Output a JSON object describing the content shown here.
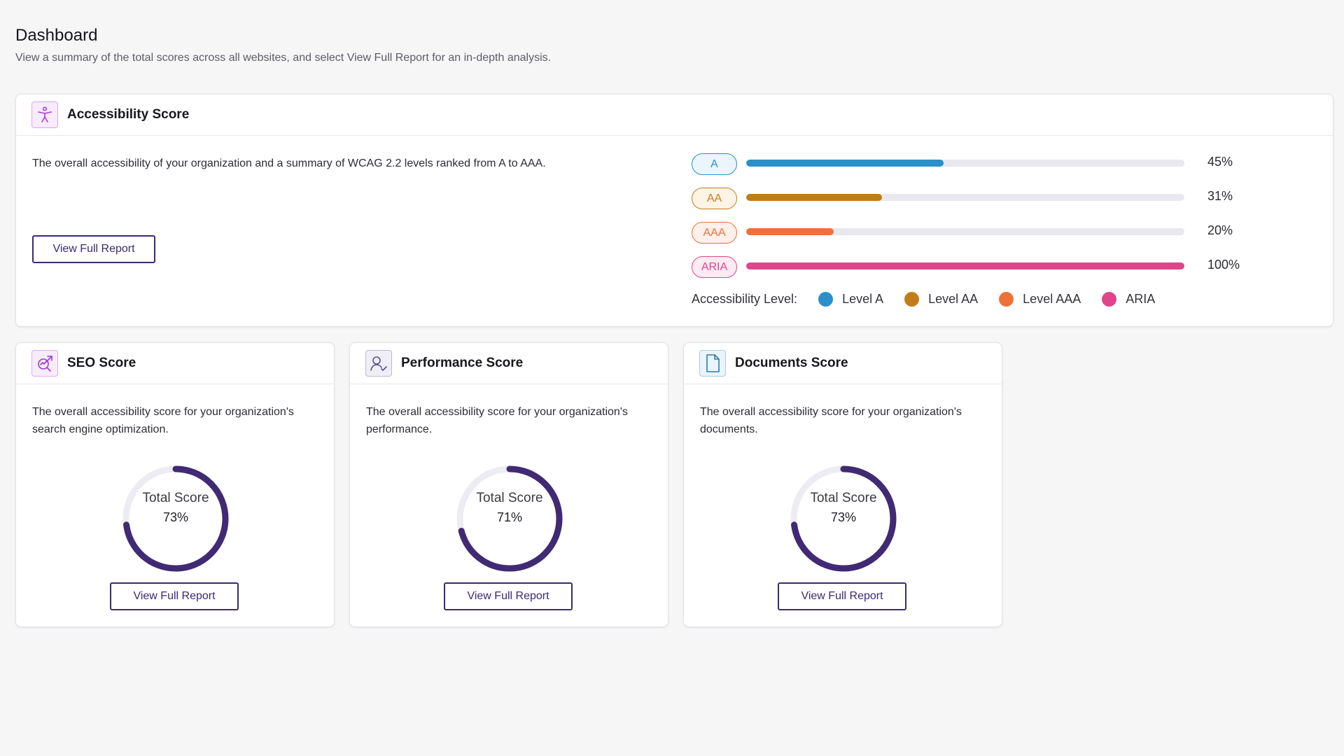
{
  "page": {
    "title": "Dashboard",
    "subtitle": "View a summary of the total scores across all websites, and select View Full Report for an in-depth analysis."
  },
  "accessibility": {
    "title": "Accessibility Score",
    "icon": "accessibility-person-icon",
    "description": "The overall accessibility of your organization and a summary of WCAG 2.2 levels ranked from A to AAA.",
    "button_label": "View Full Report",
    "levels": [
      {
        "label": "A",
        "percent_text": "45%",
        "value": 45,
        "color": "#2b8fc9",
        "pill_bg": "#eaf5fc"
      },
      {
        "label": "AA",
        "percent_text": "31%",
        "value": 31,
        "color": "#c27d19",
        "pill_bg": "#fdf4e6"
      },
      {
        "label": "AAA",
        "percent_text": "20%",
        "value": 20,
        "color": "#ee7139",
        "pill_bg": "#fdf0ea"
      },
      {
        "label": "ARIA",
        "percent_text": "100%",
        "value": 100,
        "color": "#e0448a",
        "pill_bg": "#fdebf3"
      }
    ],
    "legend": {
      "title": "Accessibility Level:",
      "items": [
        {
          "label": "Level A",
          "color": "#2b8fc9"
        },
        {
          "label": "Level AA",
          "color": "#c27d19"
        },
        {
          "label": "Level AAA",
          "color": "#ee7139"
        },
        {
          "label": "ARIA",
          "color": "#e0448a"
        }
      ]
    }
  },
  "score_cards": [
    {
      "title": "SEO Score",
      "icon": "seo-search-trend-icon",
      "description": "The overall accessibility score for your organization's search engine optimization.",
      "total_label": "Total Score",
      "value_text": "73%",
      "value": 73,
      "button_label": "View Full Report",
      "icon_color": "#a435d8",
      "icon_bg": "#f6ecfc"
    },
    {
      "title": "Performance Score",
      "icon": "performance-user-icon",
      "description": "The overall accessibility score for your organization's performance.",
      "total_label": "Total Score",
      "value_text": "71%",
      "value": 71,
      "button_label": "View Full Report",
      "icon_color": "#5a4f86",
      "icon_bg": "#efeef6"
    },
    {
      "title": "Documents Score",
      "icon": "document-icon",
      "description": "The overall accessibility score for your organization's documents.",
      "total_label": "Total Score",
      "value_text": "73%",
      "value": 73,
      "button_label": "View Full Report",
      "icon_color": "#2b7fb0",
      "icon_bg": "#eaf4fa"
    }
  ],
  "colors": {
    "donut_fill": "#402a73",
    "donut_track": "#ececf2",
    "button": "#3b2a6e"
  }
}
